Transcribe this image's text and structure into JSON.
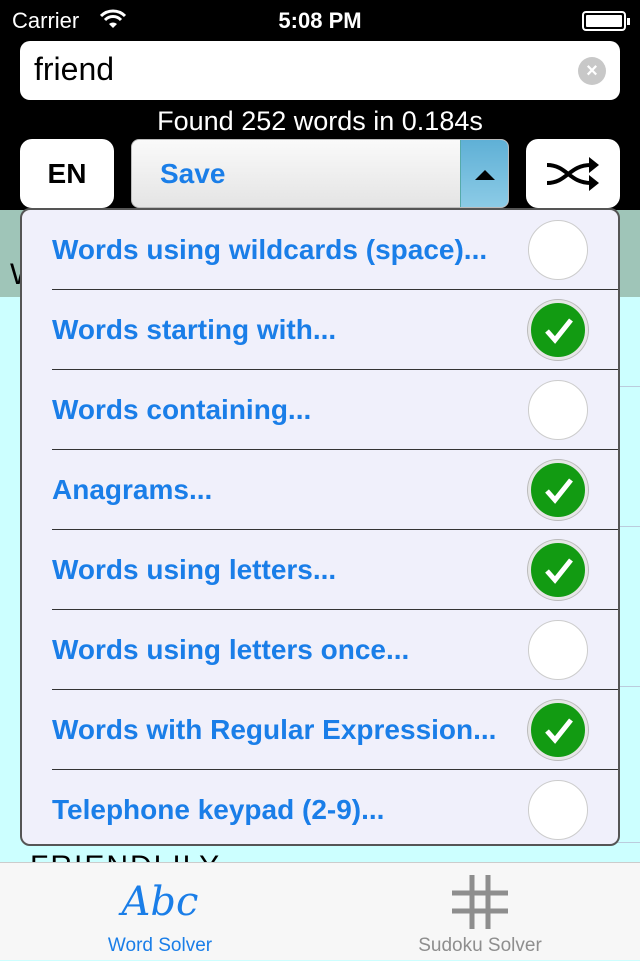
{
  "status_bar": {
    "carrier": "Carrier",
    "time": "5:08 PM",
    "battery_percent": 100
  },
  "search": {
    "value": "friend",
    "clear_icon": "clear-circle-icon"
  },
  "result_text": "Found 252 words in 0.184s",
  "language_button": "EN",
  "mode_select": {
    "value": "Save"
  },
  "shuffle_icon": "shuffle-icon",
  "background_list": {
    "header_text": "W",
    "first_visible_word": "FRIENDLILY"
  },
  "menu": {
    "items": [
      {
        "label": "Words using wildcards (space)...",
        "checked": false
      },
      {
        "label": "Words starting with...",
        "checked": true
      },
      {
        "label": "Words containing...",
        "checked": false
      },
      {
        "label": "Anagrams...",
        "checked": true
      },
      {
        "label": "Words using letters...",
        "checked": true
      },
      {
        "label": "Words using letters once...",
        "checked": false
      },
      {
        "label": "Words with Regular Expression...",
        "checked": true
      },
      {
        "label": "Telephone keypad (2-9)...",
        "checked": false
      }
    ]
  },
  "tabs": [
    {
      "label": "Word Solver",
      "icon_text": "Abc",
      "active": true,
      "color": "#1a7ee8"
    },
    {
      "label": "Sudoku Solver",
      "icon": "grid-hash-icon",
      "active": false,
      "color": "#8e8e8e"
    }
  ],
  "colors": {
    "accent": "#1a7ee8",
    "check": "#129b12",
    "list_bg": "#ccffff",
    "header_bg": "#9fc5b8"
  }
}
